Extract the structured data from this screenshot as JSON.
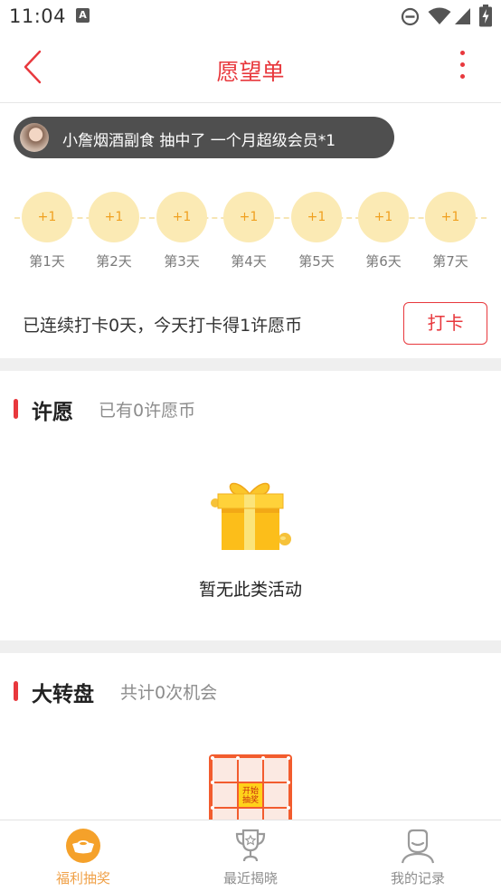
{
  "status_bar": {
    "time": "11:04",
    "notification_glyph": "A"
  },
  "header": {
    "title": "愿望单",
    "accent_color": "#e8383d"
  },
  "ticker": {
    "text": "小詹烟酒副食 抽中了 一个月超级会员*1"
  },
  "checkin": {
    "days": [
      {
        "bonus": "+1",
        "label": "第1天"
      },
      {
        "bonus": "+1",
        "label": "第2天"
      },
      {
        "bonus": "+1",
        "label": "第3天"
      },
      {
        "bonus": "+1",
        "label": "第4天"
      },
      {
        "bonus": "+1",
        "label": "第5天"
      },
      {
        "bonus": "+1",
        "label": "第6天"
      },
      {
        "bonus": "+1",
        "label": "第7天"
      }
    ],
    "summary": "已连续打卡0天，今天打卡得1许愿币",
    "button_label": "打卡"
  },
  "wish_section": {
    "title": "许愿",
    "subtitle": "已有0许愿币",
    "empty_text": "暂无此类活动"
  },
  "wheel_section": {
    "title": "大转盘",
    "subtitle": "共计0次机会",
    "center_label_line1": "开始",
    "center_label_line2": "抽奖"
  },
  "tabbar": {
    "tabs": [
      {
        "label": "福利抽奖",
        "icon": "gold-ingot-icon",
        "active": true
      },
      {
        "label": "最近揭晓",
        "icon": "trophy-icon",
        "active": false
      },
      {
        "label": "我的记录",
        "icon": "profile-icon",
        "active": false
      }
    ],
    "active_color": "#f0a24a"
  }
}
